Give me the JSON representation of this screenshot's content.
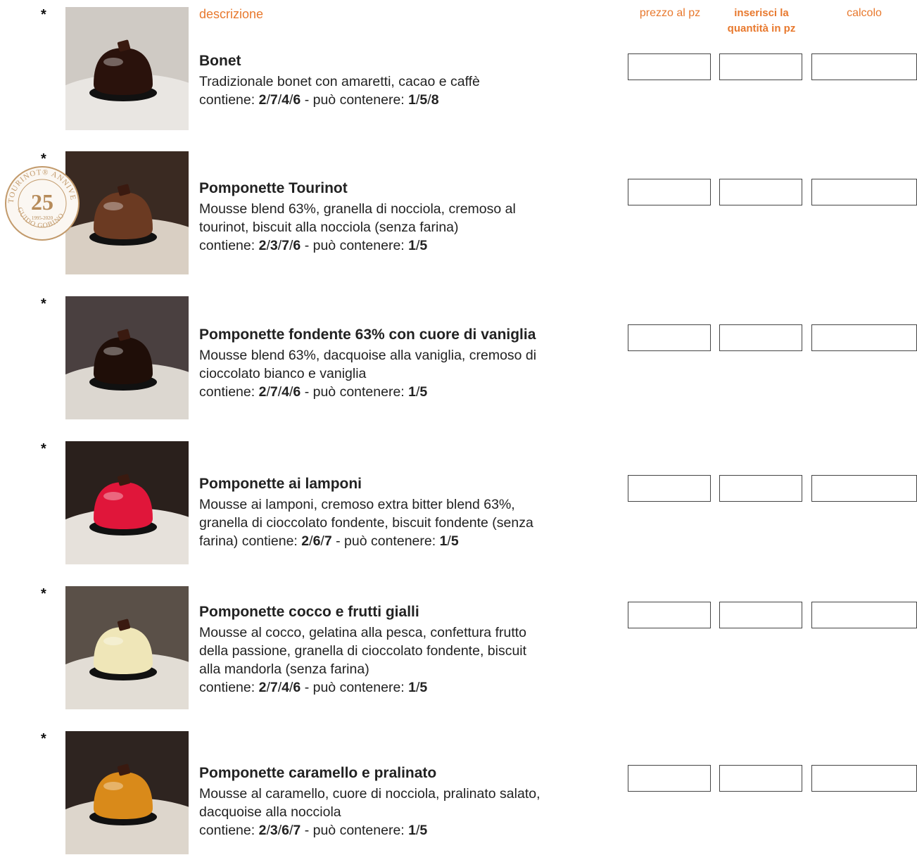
{
  "header": {
    "description": "descrizione",
    "price": "prezzo al pz",
    "quantity_line1": "inserisci la",
    "quantity_line2": "quantità in pz",
    "calc": "calcolo"
  },
  "badge": {
    "number": "25",
    "text_top": "TOURINOT® ANNIVERSARY",
    "text_bottom": "GUIDO GOBINO",
    "years": "1995-2020",
    "color": "#c29a6b"
  },
  "products": [
    {
      "star": "*",
      "title": "Bonet",
      "lines": [
        "Tradizionale bonet con amaretti, cacao e caffè"
      ],
      "contains_label": "contiene:",
      "contains": [
        "2",
        "7",
        "4",
        "6"
      ],
      "may_label": "- può contenere:",
      "may": [
        "1",
        "5",
        "8"
      ],
      "inline_contains": false,
      "colors": {
        "cake": "#2a120c",
        "plate": "#e9e6e2",
        "bg": "#cfcac4"
      }
    },
    {
      "star": "*",
      "title": "Pomponette Tourinot",
      "lines": [
        "Mousse blend 63%, granella di nocciola, cremoso al",
        "tourinot, biscuit alla nocciola (senza farina)"
      ],
      "contains_label": "contiene:",
      "contains": [
        "2",
        "3",
        "7",
        "6"
      ],
      "may_label": "- può contenere:",
      "may": [
        "1",
        "5"
      ],
      "inline_contains": false,
      "colors": {
        "cake": "#6b3a22",
        "plate": "#d9cfc3",
        "bg": "#3a2a22"
      }
    },
    {
      "star": "*",
      "title": "Pomponette fondente 63% con cuore di vaniglia",
      "lines": [
        "Mousse blend 63%, dacquoise alla vaniglia, cremoso di",
        "cioccolato bianco e vaniglia"
      ],
      "contains_label": "contiene:",
      "contains": [
        "2",
        "7",
        "4",
        "6"
      ],
      "may_label": "- può contenere:",
      "may": [
        "1",
        "5"
      ],
      "inline_contains": false,
      "colors": {
        "cake": "#1f0e08",
        "plate": "#dcd7d0",
        "bg": "#4a4040"
      }
    },
    {
      "star": "*",
      "title": "Pomponette ai lamponi",
      "lines": [
        "Mousse ai lamponi, cremoso extra bitter blend 63%,",
        "granella di cioccolato fondente, biscuit fondente (senza"
      ],
      "last_prefix": "farina)",
      "contains_label": "contiene:",
      "contains": [
        "2",
        "6",
        "7"
      ],
      "may_label": "- può contenere:",
      "may": [
        "1",
        "5"
      ],
      "inline_contains": true,
      "colors": {
        "cake": "#e0163a",
        "plate": "#e6e1db",
        "bg": "#2a201c"
      }
    },
    {
      "star": "*",
      "title": "Pomponette cocco e frutti gialli",
      "lines": [
        "Mousse al cocco, gelatina alla pesca, confettura frutto",
        "della passione, granella di cioccolato fondente, biscuit",
        "alla mandorla (senza farina)"
      ],
      "contains_label": "contiene:",
      "contains": [
        "2",
        "7",
        "4",
        "6"
      ],
      "may_label": "- può contenere:",
      "may": [
        "1",
        "5"
      ],
      "inline_contains": false,
      "colors": {
        "cake": "#efe6b8",
        "plate": "#e2ddd5",
        "bg": "#5a5048"
      }
    },
    {
      "star": "*",
      "title": "Pomponette caramello e pralinato",
      "lines": [
        "Mousse al caramello, cuore di nocciola, pralinato salato,",
        "dacquoise alla nocciola"
      ],
      "contains_label": "contiene:",
      "contains": [
        "2",
        "3",
        "6",
        "7"
      ],
      "may_label": "- può contenere:",
      "may": [
        "1",
        "5"
      ],
      "inline_contains": false,
      "colors": {
        "cake": "#d98a1a",
        "plate": "#ddd6cc",
        "bg": "#2e2420"
      }
    }
  ],
  "inputs": {
    "price_placeholder": "",
    "qty_placeholder": "",
    "calc_placeholder": ""
  }
}
